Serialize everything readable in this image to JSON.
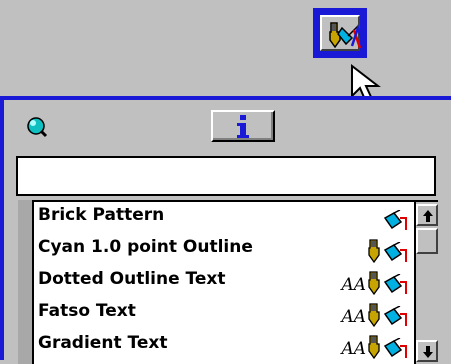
{
  "toolbar": {
    "button_icon": "fill-outline-icon"
  },
  "palette": {
    "header_icon": "globe-icon",
    "info_button_icon": "info-icon",
    "name_field_value": "",
    "styles": [
      {
        "label": "Brick Pattern",
        "icons": [
          "fill-icon"
        ]
      },
      {
        "label": "Cyan 1.0 point Outline",
        "icons": [
          "pen-icon",
          "fill-icon"
        ]
      },
      {
        "label": "Dotted Outline Text",
        "icons": [
          "text-aa-icon",
          "pen-icon",
          "fill-icon"
        ]
      },
      {
        "label": "Fatso Text",
        "icons": [
          "text-aa-icon",
          "pen-icon",
          "fill-icon"
        ]
      },
      {
        "label": "Gradient Text",
        "icons": [
          "text-aa-icon",
          "pen-icon",
          "fill-icon"
        ]
      }
    ],
    "aa_glyph": "AA"
  },
  "colors": {
    "accent": "#1a1ad6",
    "face": "#c0c0c0"
  }
}
